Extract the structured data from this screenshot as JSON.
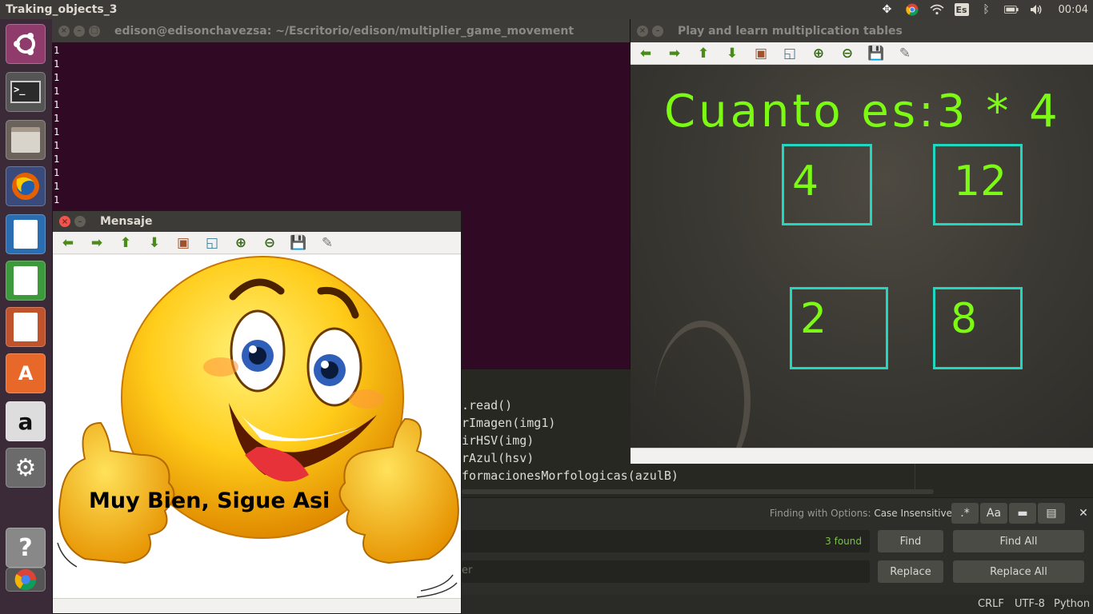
{
  "topbar": {
    "app_title": "Traking_objects_3",
    "keyboard_layout": "Es",
    "clock": "00:04"
  },
  "launcher": {
    "items": [
      "ubuntu-dash",
      "terminal",
      "file-manager",
      "firefox",
      "libreoffice-writer",
      "libreoffice-calc",
      "libreoffice-impress",
      "software-center",
      "amazon",
      "system-settings",
      "help"
    ]
  },
  "terminal": {
    "title": "edison@edisonchavezsa: ~/Escritorio/edison/multiplier_game_movement",
    "lines": [
      "1",
      "1",
      "1",
      "1",
      "1",
      "1",
      "1",
      "1",
      "1",
      "1",
      "1",
      "1"
    ]
  },
  "editor": {
    "code_lines": [
      ".read()",
      "rImagen(img1)",
      "irHSV(img)",
      "rAzul(hsv)",
      "formacionesMorfologicas(azulB)"
    ],
    "find_options_label": "Finding with Options:",
    "find_options_value": "Case Insensitive",
    "opt_regex": ".*",
    "opt_case": "Aa",
    "found_count": "3 found",
    "find_label": "Find",
    "find_all_label": "Find All",
    "replace_placeholder": "er",
    "replace_label": "Replace",
    "replace_all_label": "Replace All",
    "status_line_ending": "CRLF",
    "status_encoding": "UTF-8",
    "status_syntax": "Python"
  },
  "camera_window": {
    "title": "Play and learn multiplication tables",
    "question": "Cuanto es:3 * 4",
    "answers": [
      "4",
      "12",
      "2",
      "8"
    ]
  },
  "message_window": {
    "title": "Mensaje",
    "text": "Muy Bien, Sigue Asi"
  },
  "colors": {
    "accent_green": "#7dfa14",
    "box_cyan": "#20d8c0",
    "terminal_bg": "#300a24",
    "close_red": "#f0544c"
  }
}
